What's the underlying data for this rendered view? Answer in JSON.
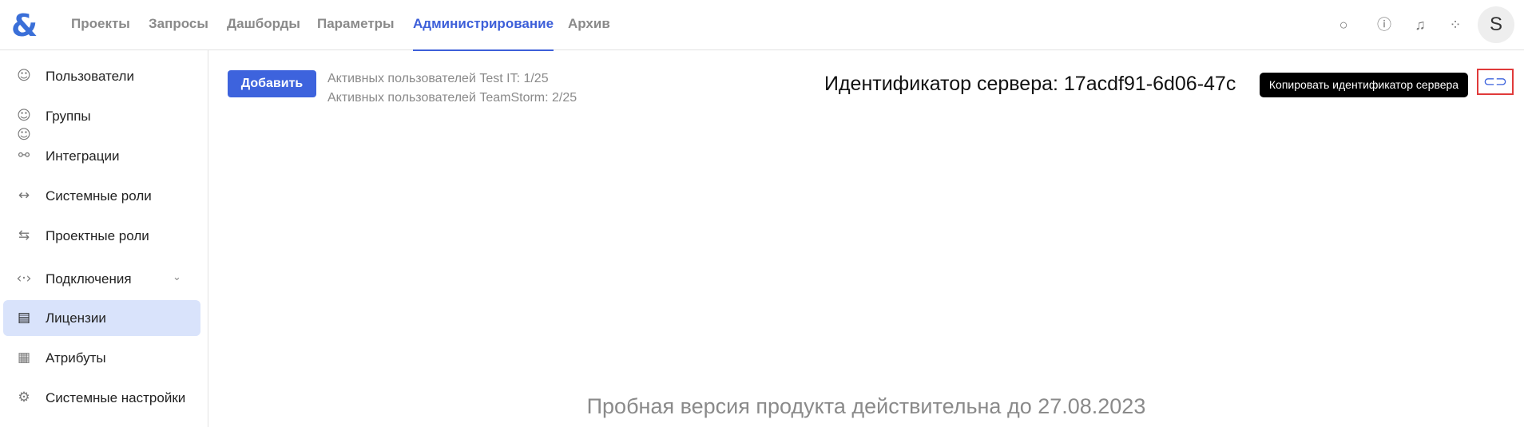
{
  "header": {
    "nav": [
      {
        "label": "Проекты"
      },
      {
        "label": "Запросы"
      },
      {
        "label": "Дашборды"
      },
      {
        "label": "Параметры"
      },
      {
        "label": "Администрирование",
        "active": true
      },
      {
        "label": "Архив"
      }
    ],
    "avatar_letter": "S"
  },
  "sidebar": {
    "items": [
      {
        "label": "Пользователи",
        "icon": "user-icon"
      },
      {
        "label": "Группы",
        "icon": "group-icon"
      },
      {
        "label": "Интеграции",
        "icon": "integrations-icon"
      },
      {
        "label": "Системные роли",
        "icon": "system-roles-icon"
      },
      {
        "label": "Проектные роли",
        "icon": "project-roles-icon"
      },
      {
        "label": "Подключения",
        "icon": "connections-icon"
      },
      {
        "label": "Лицензии",
        "icon": "license-icon",
        "active": true
      },
      {
        "label": "Атрибуты",
        "icon": "attributes-icon"
      },
      {
        "label": "Системные настройки",
        "icon": "gear-icon"
      }
    ]
  },
  "main": {
    "add_label": "Добавить",
    "active_testit": "Активных пользователей Test IT: 1/25",
    "active_teamstorm": "Активных пользователей TeamStorm: 2/25",
    "server_id": "Идентификатор сервера: 17acdf91-6d06-47c",
    "copy_tooltip": "Копировать идентификатор сервера",
    "trial": "Пробная версия продукта действительна до 27.08.2023"
  },
  "colors": {
    "accent": "#3d63dd",
    "active_bg": "#d9e3fb",
    "highlight": "#e03a3a"
  }
}
